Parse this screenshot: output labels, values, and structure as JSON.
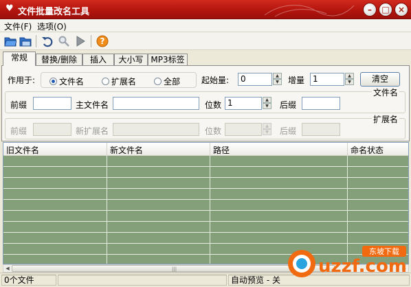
{
  "window": {
    "title": "文件批量改名工具",
    "controls": [
      "–",
      "□",
      "×"
    ]
  },
  "menu": {
    "items": [
      "文件(F)",
      "选项(O)"
    ]
  },
  "toolbar": {
    "buttons": [
      "open-folder-icon",
      "save-icon",
      "undo-icon",
      "search-icon",
      "play-icon",
      "help-icon"
    ]
  },
  "tabs": [
    "常规",
    "替换/删除",
    "插入",
    "大小写",
    "MP3标签"
  ],
  "general": {
    "apply_to_label": "作用于:",
    "options": [
      "文件名",
      "扩展名",
      "全部"
    ],
    "selected": "文件名",
    "start_label": "起始量:",
    "start_value": "0",
    "step_label": "增量",
    "step_value": "1",
    "clear_button": "清空",
    "filename_group": "文件名",
    "prefix_label": "前缀",
    "main_name_label": "主文件名",
    "digits_label": "位数",
    "digits_value": "1",
    "suffix_label": "后缀",
    "ext_group": "扩展名",
    "ext_prefix_label": "前缀",
    "new_ext_label": "新扩展名",
    "ext_digits_label": "位数",
    "ext_suffix_label": "后缀"
  },
  "list": {
    "columns": [
      "旧文件名",
      "新文件名",
      "路径",
      "命名状态"
    ],
    "background": "#84a07a"
  },
  "status": {
    "file_count": "0个文件",
    "auto_preview": "自动预览 - 关"
  },
  "watermark": {
    "text": "uzzf.com",
    "badge": "东坡下载"
  },
  "colors": {
    "title_bar": "#b3150e",
    "accent": "#1c5cb5"
  }
}
